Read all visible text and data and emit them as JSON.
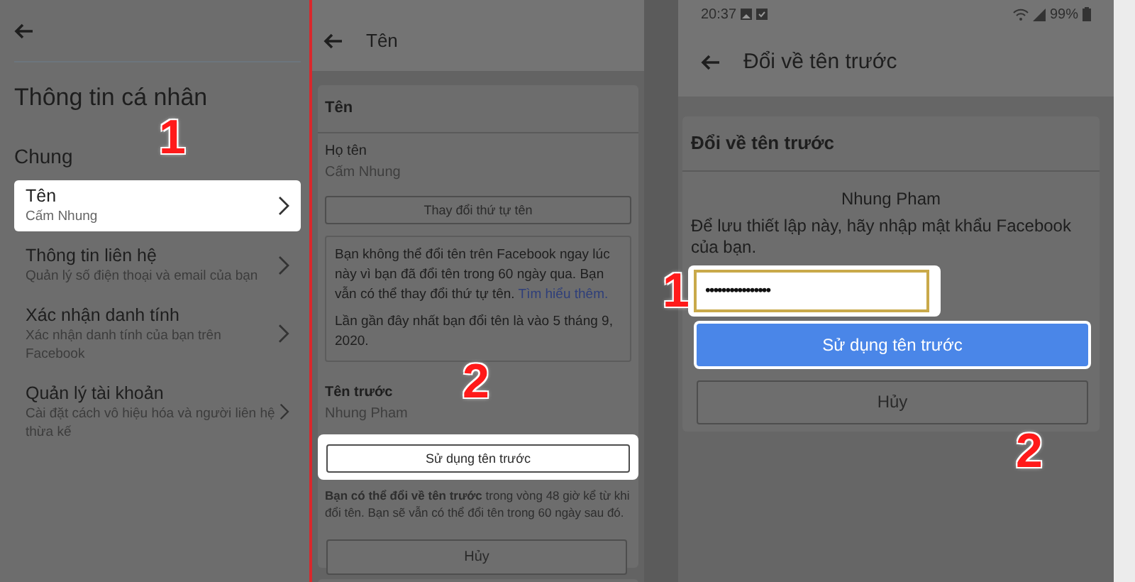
{
  "panel_1": {
    "title": "Thông tin cá nhân",
    "section": "Chung",
    "step": "1",
    "items": [
      {
        "title": "Tên",
        "subtitle": "Cấm Nhung",
        "highlighted": true
      },
      {
        "title": "Thông tin liên hệ",
        "subtitle": "Quản lý số điện thoại và email của bạn",
        "highlighted": false
      },
      {
        "title": "Xác nhận danh tính",
        "subtitle": "Xác nhận danh tính của bạn trên Facebook",
        "highlighted": false
      },
      {
        "title": "Quản lý tài khoản",
        "subtitle": "Cài đặt cách vô hiệu hóa và người liên hệ thừa kế",
        "highlighted": false
      }
    ]
  },
  "panel_2": {
    "header_title": "Tên",
    "card_title": "Tên",
    "full_name_label": "Họ tên",
    "full_name": "Cấm Nhung",
    "reorder_button": "Thay đổi thứ tự tên",
    "notice": "Bạn không thể đổi tên trên Facebook ngay lúc này vì bạn đã đổi tên trong 60 ngày qua. Bạn vẫn có thể thay đổi thứ tự tên.",
    "notice_link": "Tìm hiểu thêm.",
    "last_change": "Lần gần đây nhất bạn đổi tên là vào 5 tháng 9, 2020.",
    "previous_label": "Tên trước",
    "previous_name": "Nhung Pham",
    "use_button": {
      "label": "Sử dụng tên trước",
      "highlighted": true
    },
    "footnote": "**Bạn có thể đổi về tên trước** trong vòng 48 giờ kể từ khi đổi tên. Bạn sẽ vẫn có thể đổi tên trong 60 ngày sau đó.",
    "cancel_button": "Hủy",
    "step": "2"
  },
  "panel_3": {
    "status_time": "20:37",
    "battery": "99%",
    "header_title": "Đổi về tên trước",
    "card_title": "Đổi về tên trước",
    "name": "Nhung Pham",
    "prompt": "Để lưu thiết lập này, hãy nhập mật khẩu Facebook của bạn.",
    "password": {
      "value": "••••••••••••••••",
      "highlighted": true
    },
    "use_button": {
      "label": "Sử dụng tên trước",
      "highlighted": true
    },
    "cancel_button": "Hủy",
    "steps": [
      "1",
      "2"
    ]
  }
}
